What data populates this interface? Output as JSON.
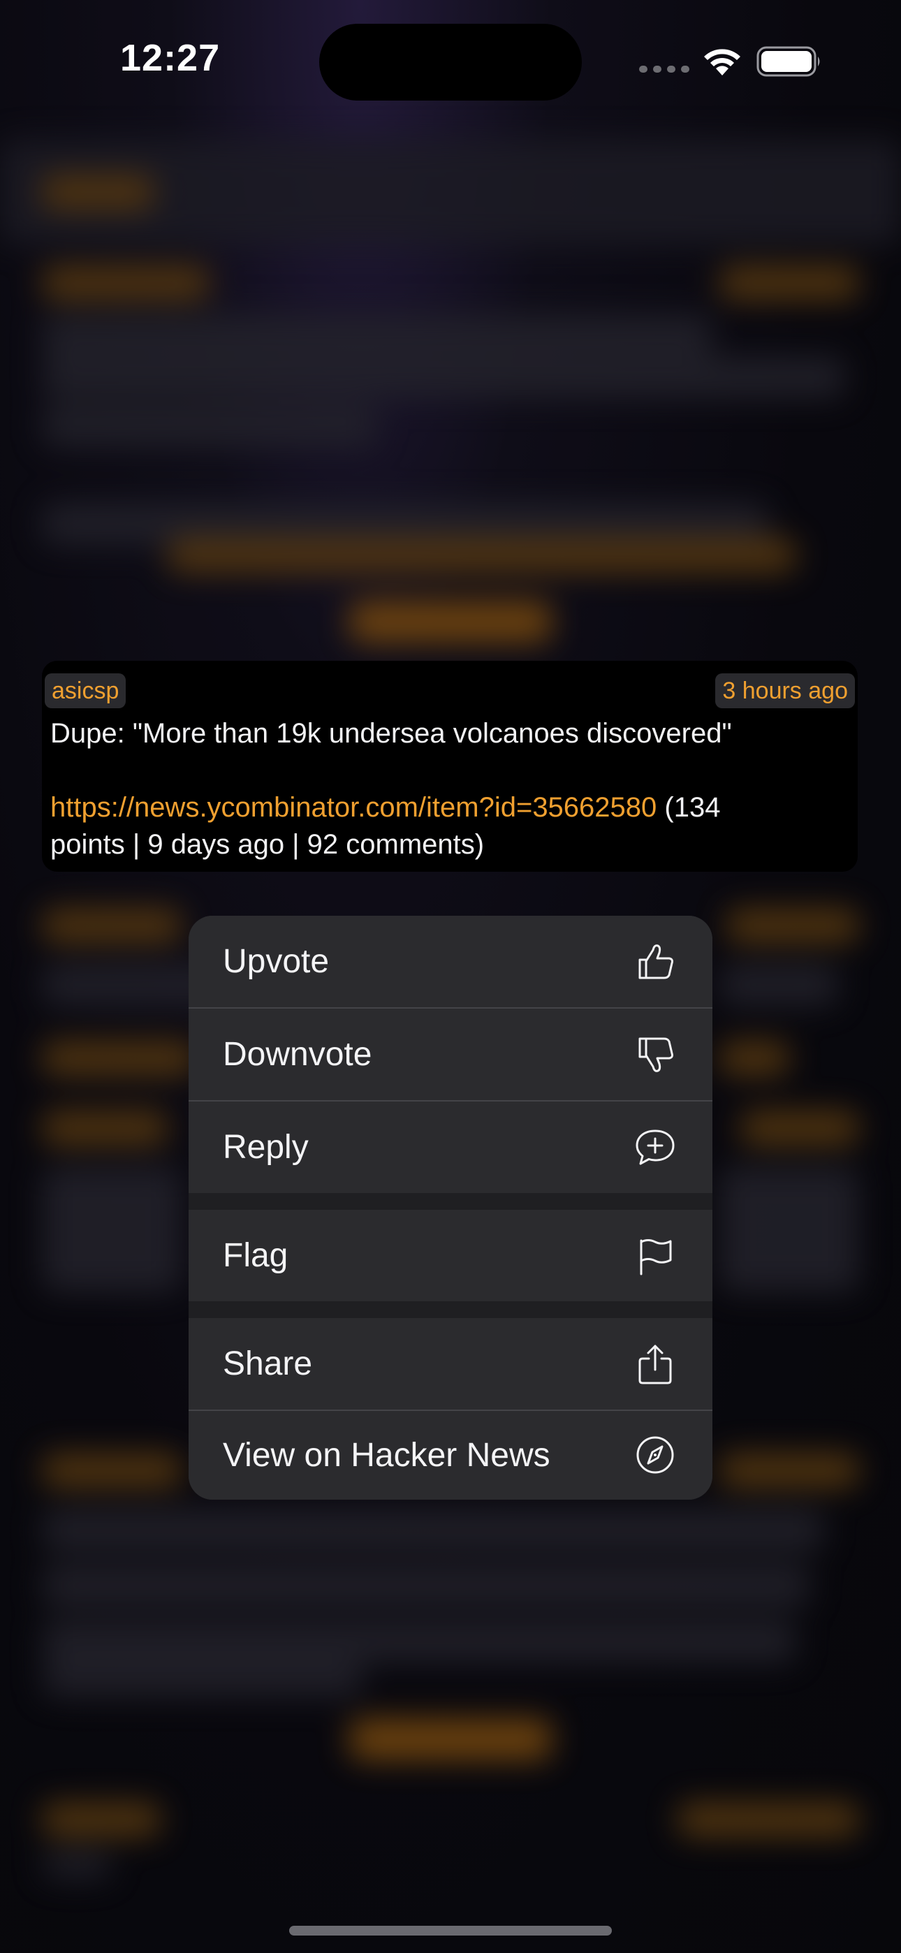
{
  "status_bar": {
    "time": "12:27"
  },
  "comment": {
    "author": "asicsp",
    "age": "3 hours ago",
    "line1": "Dupe: \"More than 19k undersea volcanoes discovered\"",
    "link": "https://news.ycombinator.com/item?id=35662580",
    "link_suffix": " (134",
    "line3": "points | 9 days ago | 92 comments)"
  },
  "context_menu": {
    "items": [
      {
        "label": "Upvote",
        "icon": "thumbs-up-icon"
      },
      {
        "label": "Downvote",
        "icon": "thumbs-down-icon"
      },
      {
        "label": "Reply",
        "icon": "reply-bubble-icon"
      },
      {
        "label": "Flag",
        "icon": "flag-icon"
      },
      {
        "label": "Share",
        "icon": "share-icon"
      },
      {
        "label": "View on Hacker News",
        "icon": "compass-icon"
      }
    ]
  },
  "colors": {
    "accent": "#f0a030",
    "menu_background": "#2b2b2e",
    "card_background": "#000000"
  }
}
